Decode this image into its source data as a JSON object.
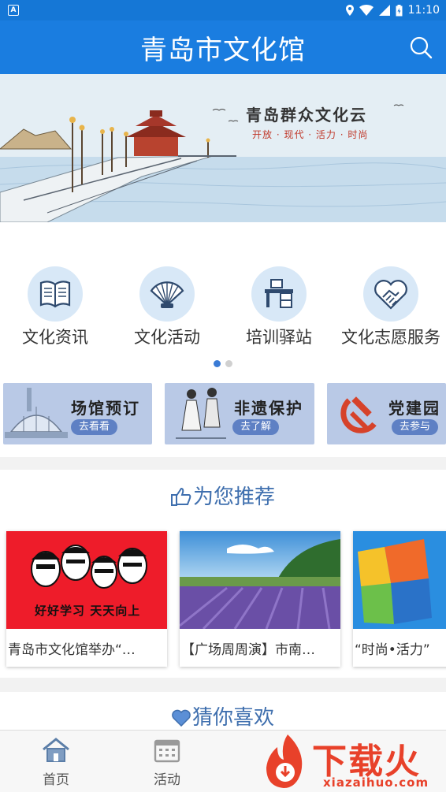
{
  "status_bar": {
    "time": "11:10"
  },
  "app_bar": {
    "title": "青岛市文化馆"
  },
  "banner": {
    "title": "青岛群众文化云",
    "subtitle": "开放 · 现代 · 活力 · 时尚"
  },
  "categories": [
    {
      "label": "文化资讯",
      "icon": "book-icon"
    },
    {
      "label": "文化活动",
      "icon": "fan-icon"
    },
    {
      "label": "培训驿站",
      "icon": "desk-icon"
    },
    {
      "label": "文化志愿服务",
      "icon": "heart-handshake-icon"
    }
  ],
  "promos": [
    {
      "title": "场馆预订",
      "button": "去看看"
    },
    {
      "title": "非遗保护",
      "button": "去了解"
    },
    {
      "title": "党建园",
      "button": "去参与"
    }
  ],
  "recommend": {
    "title": "为您推荐",
    "cards": [
      {
        "text": "青岛市文化馆举办“…",
        "image_text": "好好学习 天天向上"
      },
      {
        "text": "【广场周周演】市南…"
      },
      {
        "text": "“时尚•活力”"
      }
    ]
  },
  "guess": {
    "title": "猜你喜欢"
  },
  "tabs": [
    {
      "label": "首页",
      "icon": "home-icon"
    },
    {
      "label": "活动",
      "icon": "calendar-icon"
    }
  ],
  "watermark": {
    "text": "下载火",
    "domain": "xiazaihuo.com"
  },
  "colors": {
    "primary": "#1a7de0",
    "accent_text": "#3f6fae",
    "watermark": "#e8412a"
  }
}
